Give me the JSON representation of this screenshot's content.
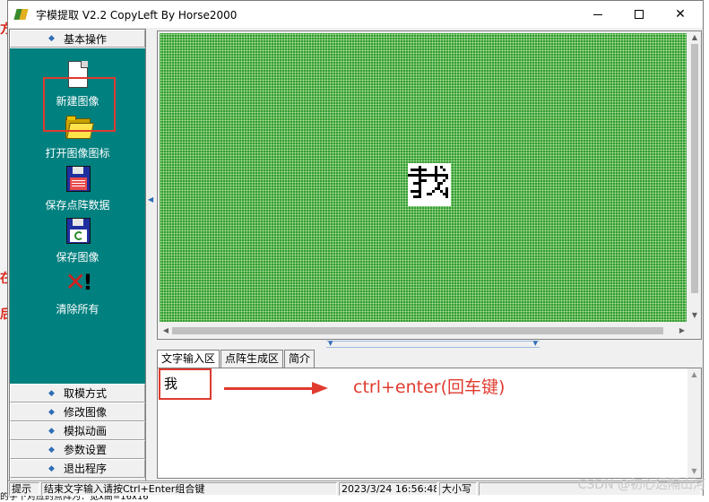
{
  "window": {
    "title": "字模提取 V2.2  CopyLeft By Horse2000"
  },
  "left_panel": {
    "group_header": "基本操作",
    "tools": [
      {
        "label": "新建图像",
        "icon": "new-document-icon"
      },
      {
        "label": "打开图像图标",
        "icon": "folder-open-icon"
      },
      {
        "label": "保存点阵数据",
        "icon": "floppy-save-icon"
      },
      {
        "label": "保存图像",
        "icon": "floppy-recycle-icon"
      },
      {
        "label": "清除所有",
        "icon": "clear-all-icon"
      }
    ],
    "menu": [
      {
        "label": "取模方式"
      },
      {
        "label": "修改图像"
      },
      {
        "label": "模拟动画"
      },
      {
        "label": "参数设置"
      },
      {
        "label": "退出程序"
      }
    ]
  },
  "canvas": {
    "grid_color": "#2e9a2e",
    "dot_color": "#b9e6a6"
  },
  "tabs": [
    {
      "label": "文字输入区",
      "active": true
    },
    {
      "label": "点阵生成区",
      "active": false
    },
    {
      "label": "简介",
      "active": false
    }
  ],
  "text_input": {
    "value": "我"
  },
  "annotation": {
    "text": "ctrl+enter(回车键)",
    "color": "#e03a2f"
  },
  "statusbar": {
    "hint": "提示",
    "message": "结束文字输入请按Ctrl+Enter组合键",
    "time": "2023/3/24 16:56:48",
    "caps": "大小写"
  },
  "watermark": "CSDN @初心远隔山河",
  "background_text": {
    "bottom_line": "的字下对应的点阵为：宽x高=16x16"
  }
}
